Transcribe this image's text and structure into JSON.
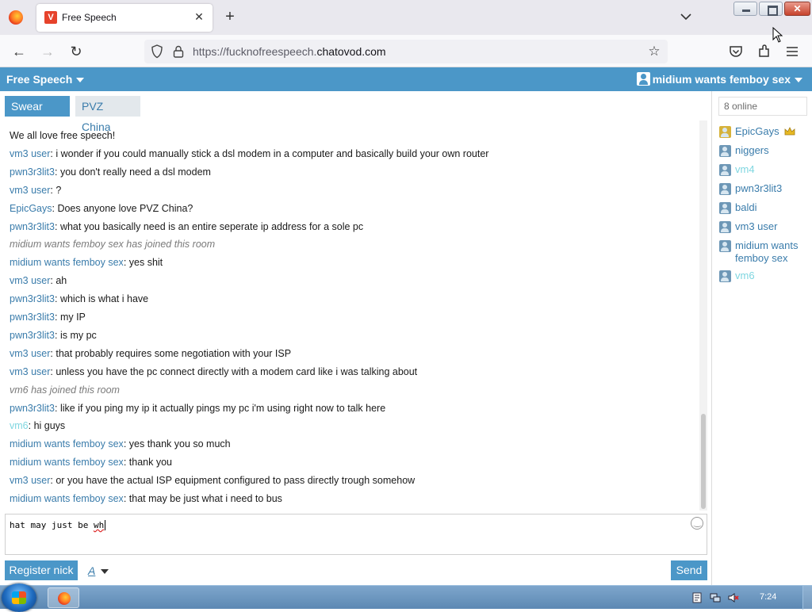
{
  "browser": {
    "tab_title": "Free Speech",
    "url_prefix": "https://fucknofreespeech.",
    "url_domain": "chatovod.com"
  },
  "chat": {
    "room_title": "Free Speech",
    "current_user": "midium wants femboy sex",
    "room_tabs": [
      "Swear Chat",
      "PVZ China"
    ],
    "online_count": "8 online",
    "messages": [
      {
        "nick": "",
        "text": "We all love free speech!"
      },
      {
        "nick": "vm3 user",
        "text": "i wonder if you could manually stick a dsl modem in a computer and basically build your own router"
      },
      {
        "nick": "pwn3r3lit3",
        "text": "you don't really need a dsl modem"
      },
      {
        "nick": "vm3 user",
        "text": "?"
      },
      {
        "nick": "EpicGays",
        "text": "Does anyone love PVZ China?"
      },
      {
        "nick": "pwn3r3lit3",
        "text": "what you basically need is an entire seperate ip address for a sole pc"
      },
      {
        "system": "midium wants femboy sex has joined this room"
      },
      {
        "nick": "midium wants femboy sex",
        "text": "yes shit"
      },
      {
        "nick": "vm3 user",
        "text": "ah"
      },
      {
        "nick": "pwn3r3lit3",
        "text": "which is what i have"
      },
      {
        "nick": "pwn3r3lit3",
        "text": "my IP"
      },
      {
        "nick": "pwn3r3lit3",
        "text": "is my pc"
      },
      {
        "nick": "vm3 user",
        "text": "that probably requires some negotiation with your ISP"
      },
      {
        "nick": "vm3 user",
        "text": "unless you have the pc connect directly with a modem card like i was talking about"
      },
      {
        "system_nick": "vm6",
        "system_text": "has joined this room"
      },
      {
        "nick": "pwn3r3lit3",
        "text": "like if you ping my ip it actually pings my pc i'm using right now to talk here"
      },
      {
        "nick": "vm6",
        "text": "hi guys",
        "light": true
      },
      {
        "nick": "midium wants femboy sex",
        "text": "yes thank you so much"
      },
      {
        "nick": "midium wants femboy sex",
        "text": "thank you"
      },
      {
        "nick": "vm3 user",
        "text": "or you have the actual ISP equipment configured to pass directly trough somehow"
      },
      {
        "nick": "midium wants femboy sex",
        "text": "that may be just what i need to bus"
      }
    ],
    "users": [
      {
        "name": "EpicGays",
        "admin": true
      },
      {
        "name": "niggers"
      },
      {
        "name": "vm4",
        "light": true
      },
      {
        "name": "pwn3r3lit3"
      },
      {
        "name": "baldi"
      },
      {
        "name": "vm3 user"
      },
      {
        "name": "midium wants femboy sex"
      },
      {
        "name": "vm6",
        "light": true
      }
    ],
    "composer_text": "hat may just be ",
    "composer_typo": "wh",
    "register_label": "Register nick",
    "format_label": "A",
    "send_label": "Send"
  },
  "taskbar": {
    "clock": "7:24"
  },
  "colors": {
    "accent": "#4b97c8",
    "nick": "#3a7cab",
    "nick_light": "#7fd6e0"
  }
}
